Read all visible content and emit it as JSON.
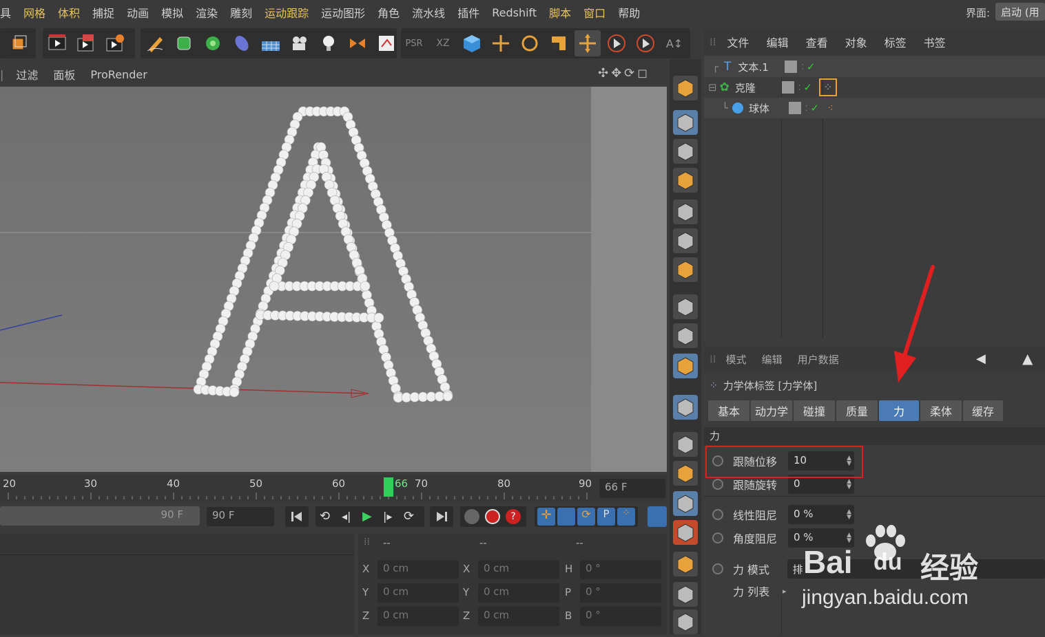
{
  "menubar": {
    "items": [
      "具",
      "网格",
      "体积",
      "捕捉",
      "动画",
      "模拟",
      "渲染",
      "雕刻",
      "运动跟踪",
      "运动图形",
      "角色",
      "流水线",
      "插件",
      "Redshift",
      "脚本",
      "窗口",
      "帮助"
    ],
    "highlighted": [
      "网格",
      "体积",
      "运动跟踪",
      "脚本",
      "窗口"
    ],
    "interface_label": "界面:",
    "interface_value": "启动 (用"
  },
  "viewport": {
    "tabs": [
      "过滤",
      "面板",
      "ProRender"
    ]
  },
  "timeline": {
    "ticks": [
      "20",
      "30",
      "40",
      "50",
      "60",
      "70",
      "80",
      "90"
    ],
    "current_frame": "66",
    "frame_field": "66 F"
  },
  "transport": {
    "end_field_a": "90 F",
    "end_field_b": "90 F"
  },
  "coords": {
    "headers": [
      "--",
      "--",
      "--"
    ],
    "rows": [
      {
        "l1": "X",
        "v1": "0 cm",
        "l2": "X",
        "v2": "0 cm",
        "l3": "H",
        "v3": "0 °"
      },
      {
        "l1": "Y",
        "v1": "0 cm",
        "l2": "Y",
        "v2": "0 cm",
        "l3": "P",
        "v3": "0 °"
      },
      {
        "l1": "Z",
        "v1": "0 cm",
        "l2": "Z",
        "v2": "0 cm",
        "l3": "B",
        "v3": "0 °"
      }
    ]
  },
  "object_manager": {
    "menu": [
      "文件",
      "编辑",
      "查看",
      "对象",
      "标签",
      "书签"
    ],
    "objects": [
      {
        "name": "文本.1",
        "icon": "text-icon"
      },
      {
        "name": "克隆",
        "icon": "cloner-icon"
      },
      {
        "name": "球体",
        "icon": "sphere-icon"
      }
    ]
  },
  "attributes": {
    "menu": [
      "模式",
      "编辑",
      "用户数据"
    ],
    "title": "力学体标签 [力学体]",
    "tabs": [
      "基本",
      "动力学",
      "碰撞",
      "质量",
      "力",
      "柔体",
      "缓存"
    ],
    "active_tab": "力",
    "section": "力",
    "params": [
      {
        "label": "跟随位移",
        "value": "10"
      },
      {
        "label": "跟随旋转",
        "value": "0"
      },
      {
        "label": "线性阻尼",
        "value": "0 %"
      },
      {
        "label": "角度阻尼",
        "value": "0 %"
      }
    ],
    "force_mode_label": "力 模式",
    "force_mode_value": "排",
    "force_list_label": "力 列表"
  },
  "watermark": {
    "brand": "Bai",
    "brand2": "du",
    "product": "经验",
    "url": "jingyan.baidu.com"
  },
  "colors": {
    "accent_tab": "#4b7bb6",
    "highlight_text": "#e8c35a",
    "annotation_red": "#e02020"
  }
}
